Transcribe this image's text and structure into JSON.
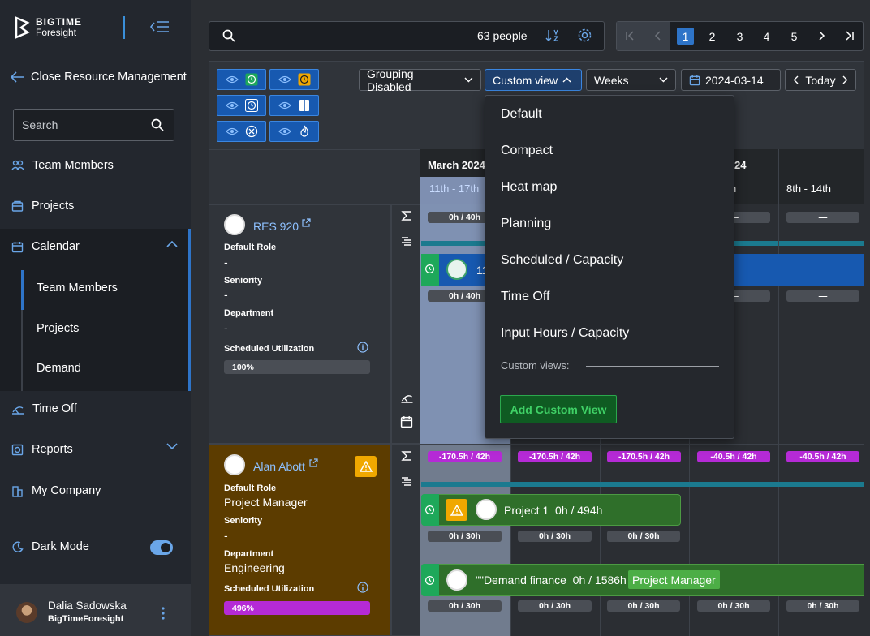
{
  "sidebar": {
    "logo_line1": "BIGTIME",
    "logo_line2": "Foresight",
    "back_label": "Close Resource Management",
    "search_placeholder": "Search",
    "items": [
      {
        "label": "Team Members",
        "icon": "team-icon"
      },
      {
        "label": "Projects",
        "icon": "projects-icon"
      },
      {
        "label": "Calendar",
        "icon": "calendar-icon",
        "expanded": true
      },
      {
        "label": "Time Off",
        "icon": "time-off-icon"
      },
      {
        "label": "Reports",
        "icon": "reports-icon"
      },
      {
        "label": "My Company",
        "icon": "company-icon"
      }
    ],
    "calendar_sub": [
      "Team Members",
      "Projects",
      "Demand"
    ],
    "dark_mode_label": "Dark Mode",
    "dark_mode_on": true,
    "user_name": "Dalia Sadowska",
    "user_org": "BigTimeForesight"
  },
  "topbar": {
    "people_count": "63 people",
    "pages": [
      "1",
      "2",
      "3",
      "4",
      "5"
    ],
    "active_page": "1"
  },
  "toolbar": {
    "grouping": "Grouping Disabled",
    "view": "Custom view",
    "period": "Weeks",
    "date": "2024-03-14",
    "today": "Today"
  },
  "calendar": {
    "month1": "March 2024",
    "month2": "24",
    "weeks": [
      "11th - 17th",
      "h",
      "8th - 14th"
    ]
  },
  "rows": [
    {
      "name": "RES 920",
      "default_role_label": "Default Role",
      "default_role": "-",
      "seniority_label": "Seniority",
      "seniority": "-",
      "department_label": "Department",
      "department": "-",
      "util_label": "Scheduled Utilization",
      "util": "100%",
      "cell_top": [
        "0h / 40h",
        "—",
        "—"
      ],
      "cell_bottom": [
        "0h / 40h",
        "—",
        "—"
      ],
      "bar_text": "11"
    },
    {
      "name": "Alan Abott",
      "default_role_label": "Default Role",
      "default_role": "Project Manager",
      "seniority_label": "Seniority",
      "seniority": "-",
      "department_label": "Department",
      "department": "Engineering",
      "util_label": "Scheduled Utilization",
      "util": "496%",
      "cell_top": [
        "-170.5h / 42h",
        "-170.5h / 42h",
        "-170.5h / 42h",
        "-40.5h / 42h",
        "-40.5h / 42h"
      ],
      "project_bar": "Project 1  0h / 494h",
      "project_cells": [
        "0h / 30h",
        "0h / 30h",
        "0h / 30h"
      ],
      "demand_bar": "\"\"Demand finance  0h / 1586h",
      "demand_tag": "Project Manager",
      "demand_cells": [
        "0h / 30h",
        "0h / 30h",
        "0h / 30h",
        "0h / 30h",
        "0h / 30h"
      ]
    }
  ],
  "menu": {
    "items": [
      "Default",
      "Compact",
      "Heat map",
      "Planning",
      "Scheduled / Capacity",
      "Time Off",
      "Input Hours / Capacity"
    ],
    "custom_views_label": "Custom views:",
    "add_button": "Add Custom View"
  },
  "colors": {
    "accent": "#2e74c8",
    "sidebar_bg": "#23272e",
    "warning": "#f0a800",
    "over_util": "#b52ad6",
    "project_green": "#2f6f2a"
  }
}
